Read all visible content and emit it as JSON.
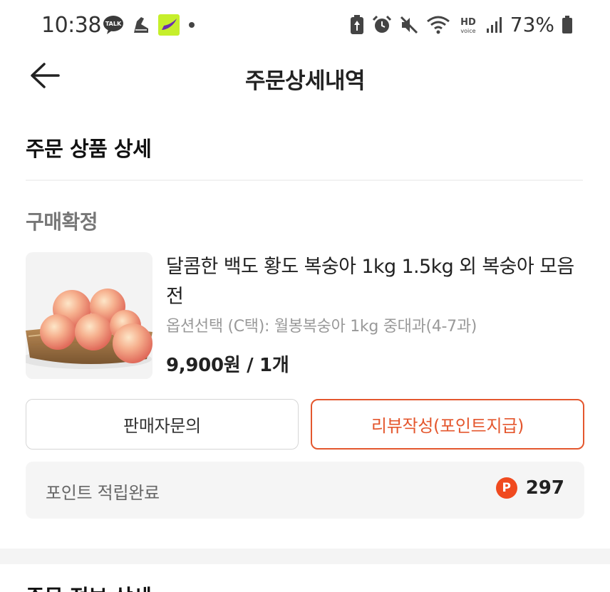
{
  "status_bar": {
    "time": "10:38",
    "battery_percent": "73%",
    "left_icons": [
      "talk-icon",
      "shoe-icon",
      "app-icon",
      "dot-icon"
    ],
    "right_icons": [
      "battery-saver-icon",
      "alarm-icon",
      "mute-icon",
      "wifi-icon",
      "hd-voice-icon",
      "signal-icon",
      "battery-icon"
    ]
  },
  "header": {
    "title": "주문상세내역",
    "back_icon": "arrow-left-icon"
  },
  "section": {
    "title": "주문 상품 상세"
  },
  "order": {
    "status": "구매확정",
    "product": {
      "name": "달콤한 백도 황도 복숭아 1kg 1.5kg 외 복숭아 모음전",
      "option": "옵션선택 (C택): 월봉복숭아 1kg 중대과(4-7과)",
      "price": "9,900원 / 1개",
      "image": "peaches-in-basket"
    },
    "buttons": {
      "inquiry": "판매자문의",
      "review": "리뷰작성(포인트지급)"
    },
    "points": {
      "label": "포인트 적립완료",
      "icon_letter": "P",
      "value": "297"
    }
  },
  "next_section": {
    "title": "주문 정보 상세"
  },
  "colors": {
    "accent": "#e4572e",
    "point_badge": "#f04a1f",
    "muted_text": "#999999"
  }
}
